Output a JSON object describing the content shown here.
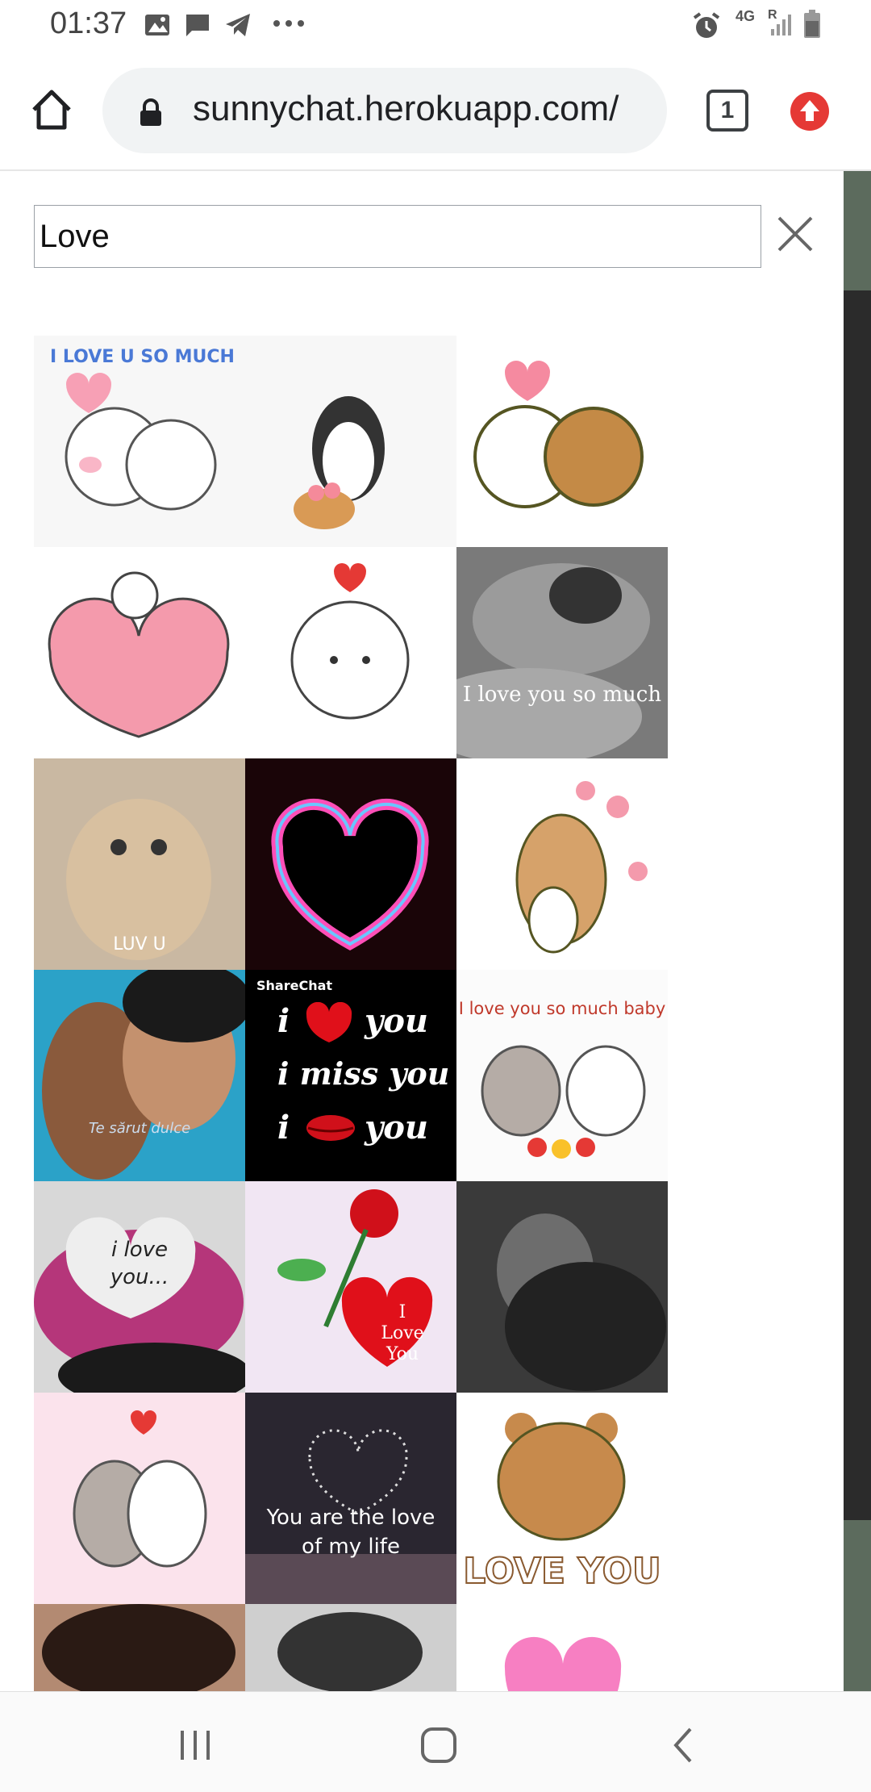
{
  "status_bar": {
    "time": "01:37",
    "icons": [
      "gallery-icon",
      "message-icon",
      "telegram-icon",
      "more-dots-icon",
      "alarm-icon",
      "network-4g-icon",
      "signal-icon",
      "battery-icon"
    ],
    "network_label": "4G",
    "roaming_label": "R"
  },
  "browser": {
    "url": "sunnychat.herokuapp.com/",
    "tab_count": "1",
    "icons": {
      "home": "home-icon",
      "lock": "lock-icon",
      "update": "update-arrow-icon"
    }
  },
  "search": {
    "value": "Love",
    "clear_icon": "close-icon"
  },
  "gif_grid": {
    "tiles": [
      {
        "caption": "I LOVE U SO MUCH"
      },
      {
        "caption": ""
      },
      {
        "caption": ""
      },
      {
        "caption": ""
      },
      {
        "caption": ""
      },
      {
        "caption": "I love you so much"
      },
      {
        "caption": "LUV U"
      },
      {
        "caption": ""
      },
      {
        "caption": ""
      },
      {
        "caption": "Te sărut dulce"
      },
      {
        "caption_brand": "ShareChat",
        "line1": "i",
        "line2": "you",
        "line3": "i miss you",
        "line4": "i",
        "line5": "you"
      },
      {
        "caption": "I love you so much baby"
      },
      {
        "caption_line1": "i love",
        "caption_line2": "you..."
      },
      {
        "caption_line1": "I",
        "caption_line2": "Love",
        "caption_line3": "You"
      },
      {
        "caption": ""
      },
      {
        "caption": ""
      },
      {
        "caption_line1": "You are the love",
        "caption_line2": "of my life"
      },
      {
        "caption": "LOVE YOU"
      },
      {
        "caption": ""
      },
      {
        "caption": ""
      },
      {
        "caption": ""
      }
    ]
  },
  "colors": {
    "scroll_thumb": "#5c6b5d",
    "scroll_track": "#2b2b2b",
    "update_badge": "#e53935"
  },
  "nav_bar": {
    "icons": [
      "recents-icon",
      "home-nav-icon",
      "back-icon"
    ]
  }
}
